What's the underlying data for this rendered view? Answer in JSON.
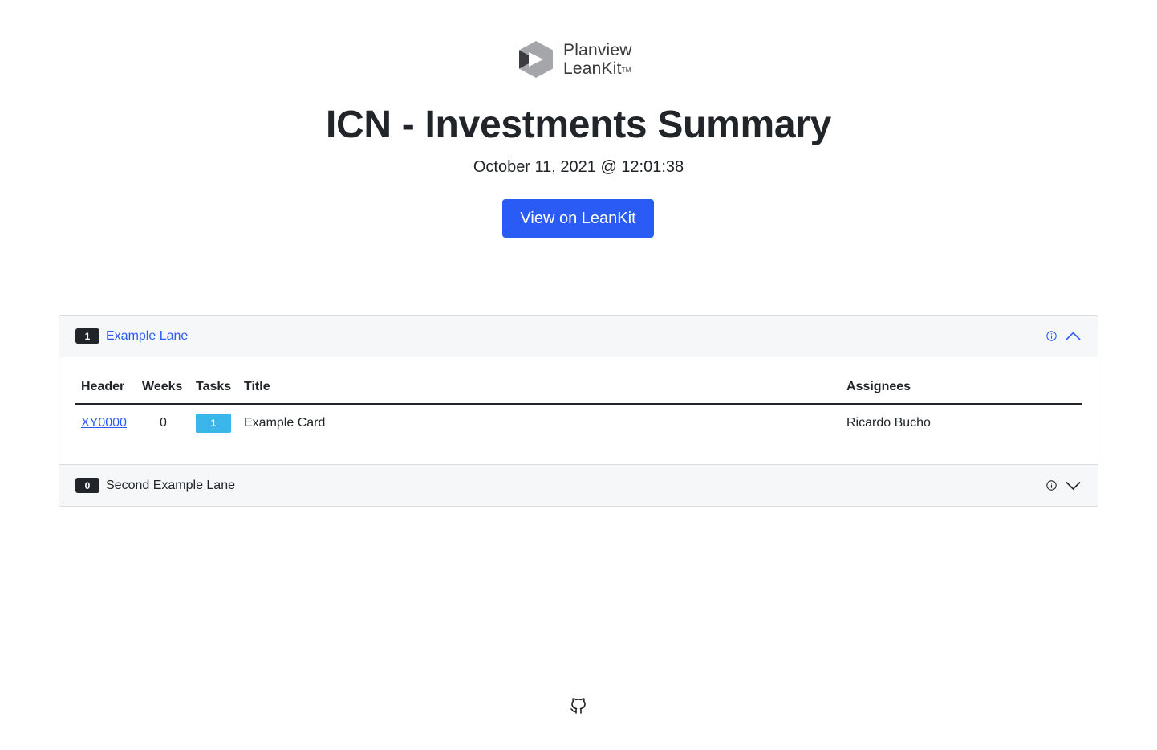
{
  "logo": {
    "line1": "Planview",
    "line2": "LeanKit",
    "trademark": "TM",
    "colors": {
      "hex_light": "#a4a6a9",
      "hex_dark": "#3b3d40"
    }
  },
  "page": {
    "title": "ICN - Investments Summary",
    "timestamp": "October 11, 2021 @ 12:01:38",
    "view_button_label": "View on LeanKit"
  },
  "lanes": [
    {
      "count": "1",
      "name": "Example Lane",
      "expanded": true,
      "table": {
        "headers": [
          "Header",
          "Weeks",
          "Tasks",
          "Title",
          "Assignees"
        ],
        "rows": [
          {
            "header": "XY0000",
            "weeks": "0",
            "tasks": "1",
            "title": "Example Card",
            "assignees": "Ricardo Bucho"
          }
        ]
      }
    },
    {
      "count": "0",
      "name": "Second Example Lane",
      "expanded": false
    }
  ],
  "footer": {
    "icon": "github-icon"
  },
  "colors": {
    "accent": "#2b5bf5",
    "task_badge": "#3bb6ea",
    "count_badge": "#212529"
  }
}
